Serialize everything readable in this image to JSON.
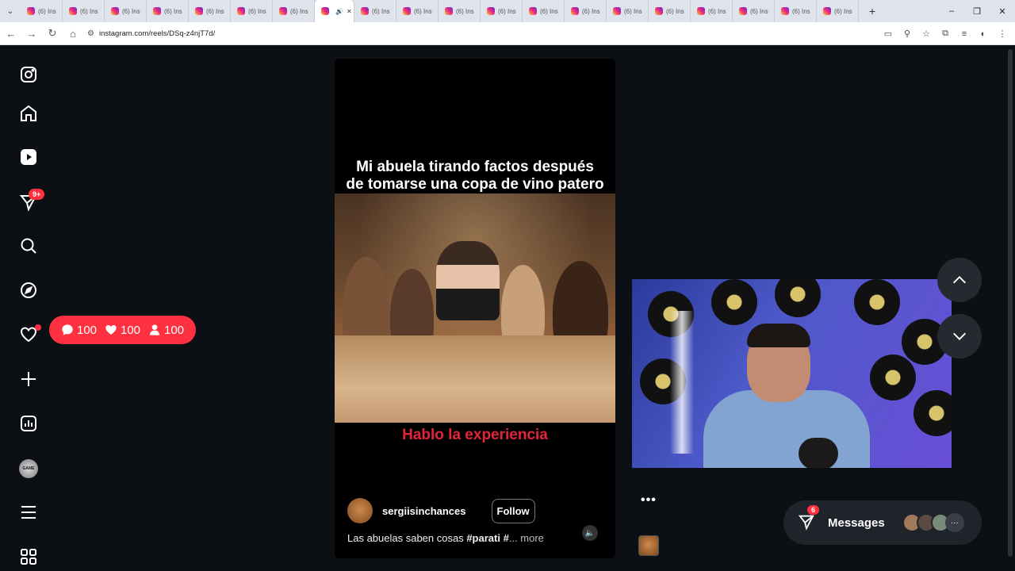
{
  "browser": {
    "tabs": [
      {
        "label": "(6) Ins"
      },
      {
        "label": "(6) Ins"
      },
      {
        "label": "(6) Ins"
      },
      {
        "label": "(6) Ins"
      },
      {
        "label": "(6) Ins"
      },
      {
        "label": "(6) Ins"
      },
      {
        "label": "(6) Ins"
      },
      {
        "label": "",
        "active": true
      },
      {
        "label": "(6) Ins"
      },
      {
        "label": "(6) Ins"
      },
      {
        "label": "(6) Ins"
      },
      {
        "label": "(6) Ins"
      },
      {
        "label": "(6) Ins"
      },
      {
        "label": "(6) Ins"
      },
      {
        "label": "(6) Ins"
      },
      {
        "label": "(6) Ins"
      },
      {
        "label": "(6) Ins"
      },
      {
        "label": "(6) Ins"
      },
      {
        "label": "(6) Ins"
      },
      {
        "label": "(6) Ins"
      }
    ],
    "url": "instagram.com/reels/DSq-z4njT7d/",
    "new_tab": "+"
  },
  "sidebar": {
    "notifications_badge": "9+"
  },
  "stats": {
    "comments": "100",
    "likes": "100",
    "followers": "100"
  },
  "reel": {
    "title_line1": "Mi abuela tirando factos después",
    "title_line2": "de tomarse una copa de vino patero",
    "subtitle": "Hablo la experiencia",
    "owner": "sergiisinchances",
    "follow_label": "Follow",
    "caption_text": "Las abuelas saben cosas ",
    "caption_hashtag": "#parati",
    "caption_tail": " #",
    "caption_more": "... more"
  },
  "messages": {
    "label": "Messages",
    "badge": "6"
  },
  "colors": {
    "accent": "#ff3040",
    "subtitle": "#e4243a",
    "background": "#0c0f13"
  }
}
